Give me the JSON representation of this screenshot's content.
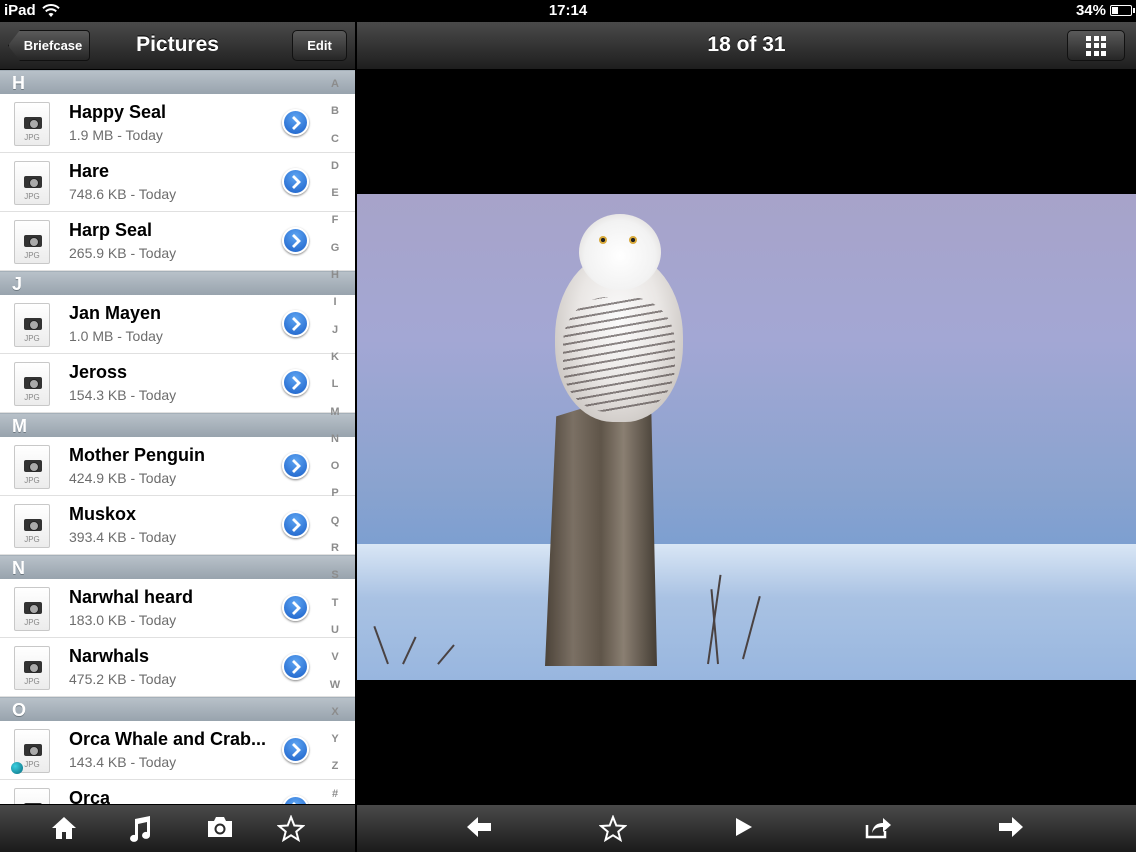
{
  "status_bar": {
    "device": "iPad",
    "time": "17:14",
    "battery": "34%",
    "battery_level": 0.34,
    "wifi_icon": "wifi-icon",
    "battery_icon": "battery-icon"
  },
  "left_nav": {
    "back_label": "Briefcase",
    "title": "Pictures",
    "edit_label": "Edit"
  },
  "sections": [
    {
      "letter": "H",
      "items": [
        {
          "title": "Happy Seal",
          "sub": "1.9 MB - Today"
        },
        {
          "title": "Hare",
          "sub": "748.6 KB - Today"
        },
        {
          "title": "Harp Seal",
          "sub": "265.9 KB - Today"
        }
      ]
    },
    {
      "letter": "J",
      "items": [
        {
          "title": "Jan Mayen",
          "sub": "1.0 MB - Today"
        },
        {
          "title": "Jeross",
          "sub": "154.3 KB - Today"
        }
      ]
    },
    {
      "letter": "M",
      "items": [
        {
          "title": "Mother Penguin",
          "sub": "424.9 KB - Today"
        },
        {
          "title": "Muskox",
          "sub": "393.4 KB - Today"
        }
      ]
    },
    {
      "letter": "N",
      "items": [
        {
          "title": "Narwhal heard",
          "sub": "183.0 KB - Today"
        },
        {
          "title": "Narwhals",
          "sub": "475.2 KB - Today"
        }
      ]
    },
    {
      "letter": "O",
      "items": [
        {
          "title": "Orca Whale and Crab...",
          "sub": "143.4 KB - Today",
          "marked": true
        },
        {
          "title": "Orca",
          "sub": ""
        }
      ]
    }
  ],
  "file_ext": "JPG",
  "index_letters": [
    "A",
    "B",
    "C",
    "D",
    "E",
    "F",
    "G",
    "H",
    "I",
    "J",
    "K",
    "L",
    "M",
    "N",
    "O",
    "P",
    "Q",
    "R",
    "S",
    "T",
    "U",
    "V",
    "W",
    "X",
    "Y",
    "Z",
    "#"
  ],
  "left_toolbar": {
    "icons": [
      "home-icon",
      "music-icon",
      "camera-icon",
      "star-icon"
    ]
  },
  "right_nav": {
    "title": "18 of 31",
    "grid_icon": "grid-icon"
  },
  "right_toolbar": {
    "icons": [
      "arrow-left-icon",
      "star-icon",
      "play-icon",
      "share-icon",
      "arrow-right-icon"
    ]
  },
  "colors": {
    "bar_dark": "#1e1e1e",
    "section_header": "#a5b0b9",
    "disclosure_blue": "#1a5fc8"
  }
}
